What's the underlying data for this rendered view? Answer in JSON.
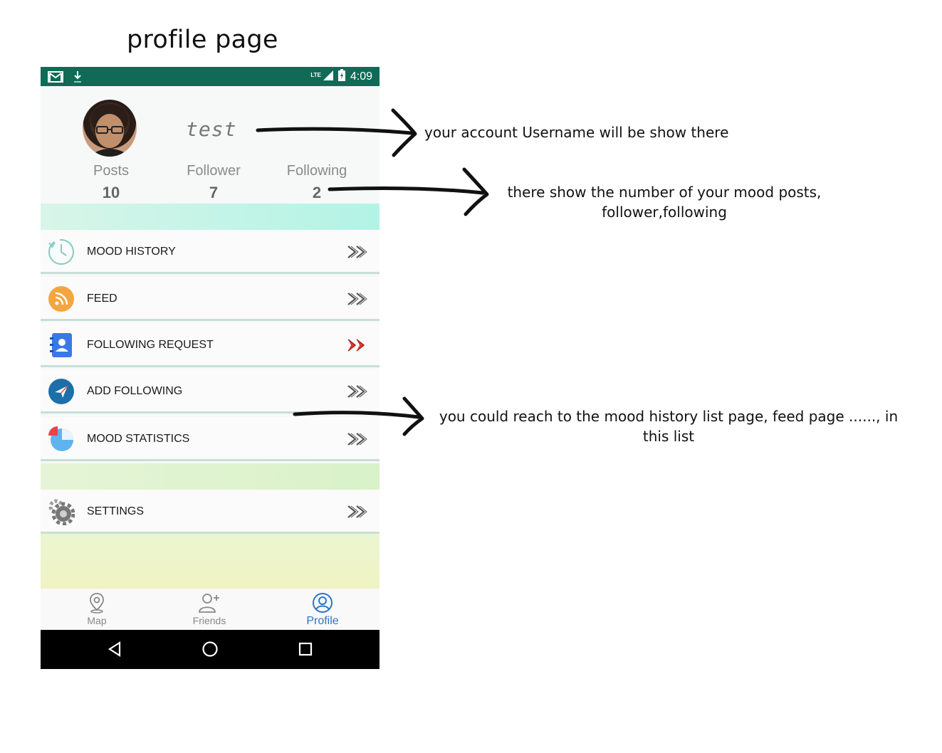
{
  "doc_title": "profile page",
  "status_bar": {
    "time": "4:09",
    "network": "LTE",
    "left_icons": [
      "gmail-icon",
      "download-icon"
    ],
    "colors": {
      "background": "#0f6b55"
    }
  },
  "profile": {
    "username": "test",
    "stats": [
      {
        "label": "Posts",
        "value": "10"
      },
      {
        "label": "Follower",
        "value": "7"
      },
      {
        "label": "Following",
        "value": "2"
      }
    ]
  },
  "menu": {
    "items": [
      {
        "label": "MOOD HISTORY",
        "icon": "clock-history-icon",
        "chevron": "double-chevron-icon"
      },
      {
        "label": "FEED",
        "icon": "rss-feed-icon",
        "chevron": "double-chevron-icon"
      },
      {
        "label": "FOLLOWING REQUEST",
        "icon": "contacts-book-icon",
        "chevron": "double-chevron-red-icon",
        "accent": "#e53935"
      },
      {
        "label": "ADD FOLLOWING",
        "icon": "paper-plane-icon",
        "chevron": "double-chevron-icon"
      },
      {
        "label": "MOOD STATISTICS",
        "icon": "pie-chart-icon",
        "chevron": "double-chevron-icon"
      }
    ],
    "settings": {
      "label": "SETTINGS",
      "icon": "gear-icon",
      "chevron": "double-chevron-icon"
    }
  },
  "bottom_nav": {
    "items": [
      {
        "label": "Map",
        "icon": "map-pin-icon",
        "active": false
      },
      {
        "label": "Friends",
        "icon": "add-friend-icon",
        "active": false
      },
      {
        "label": "Profile",
        "icon": "profile-icon",
        "active": true
      }
    ],
    "active_color": "#2b75c7"
  },
  "system_nav": {
    "icons": [
      "back-icon",
      "home-icon",
      "recents-icon"
    ]
  },
  "annotations": [
    {
      "text": "your account Username will be show there"
    },
    {
      "text_line1": "there show the number of your mood posts,",
      "text_line2": "follower,following"
    },
    {
      "text_line1": "you could reach to the mood history list page, feed page ......, in",
      "text_line2": "this list"
    }
  ]
}
